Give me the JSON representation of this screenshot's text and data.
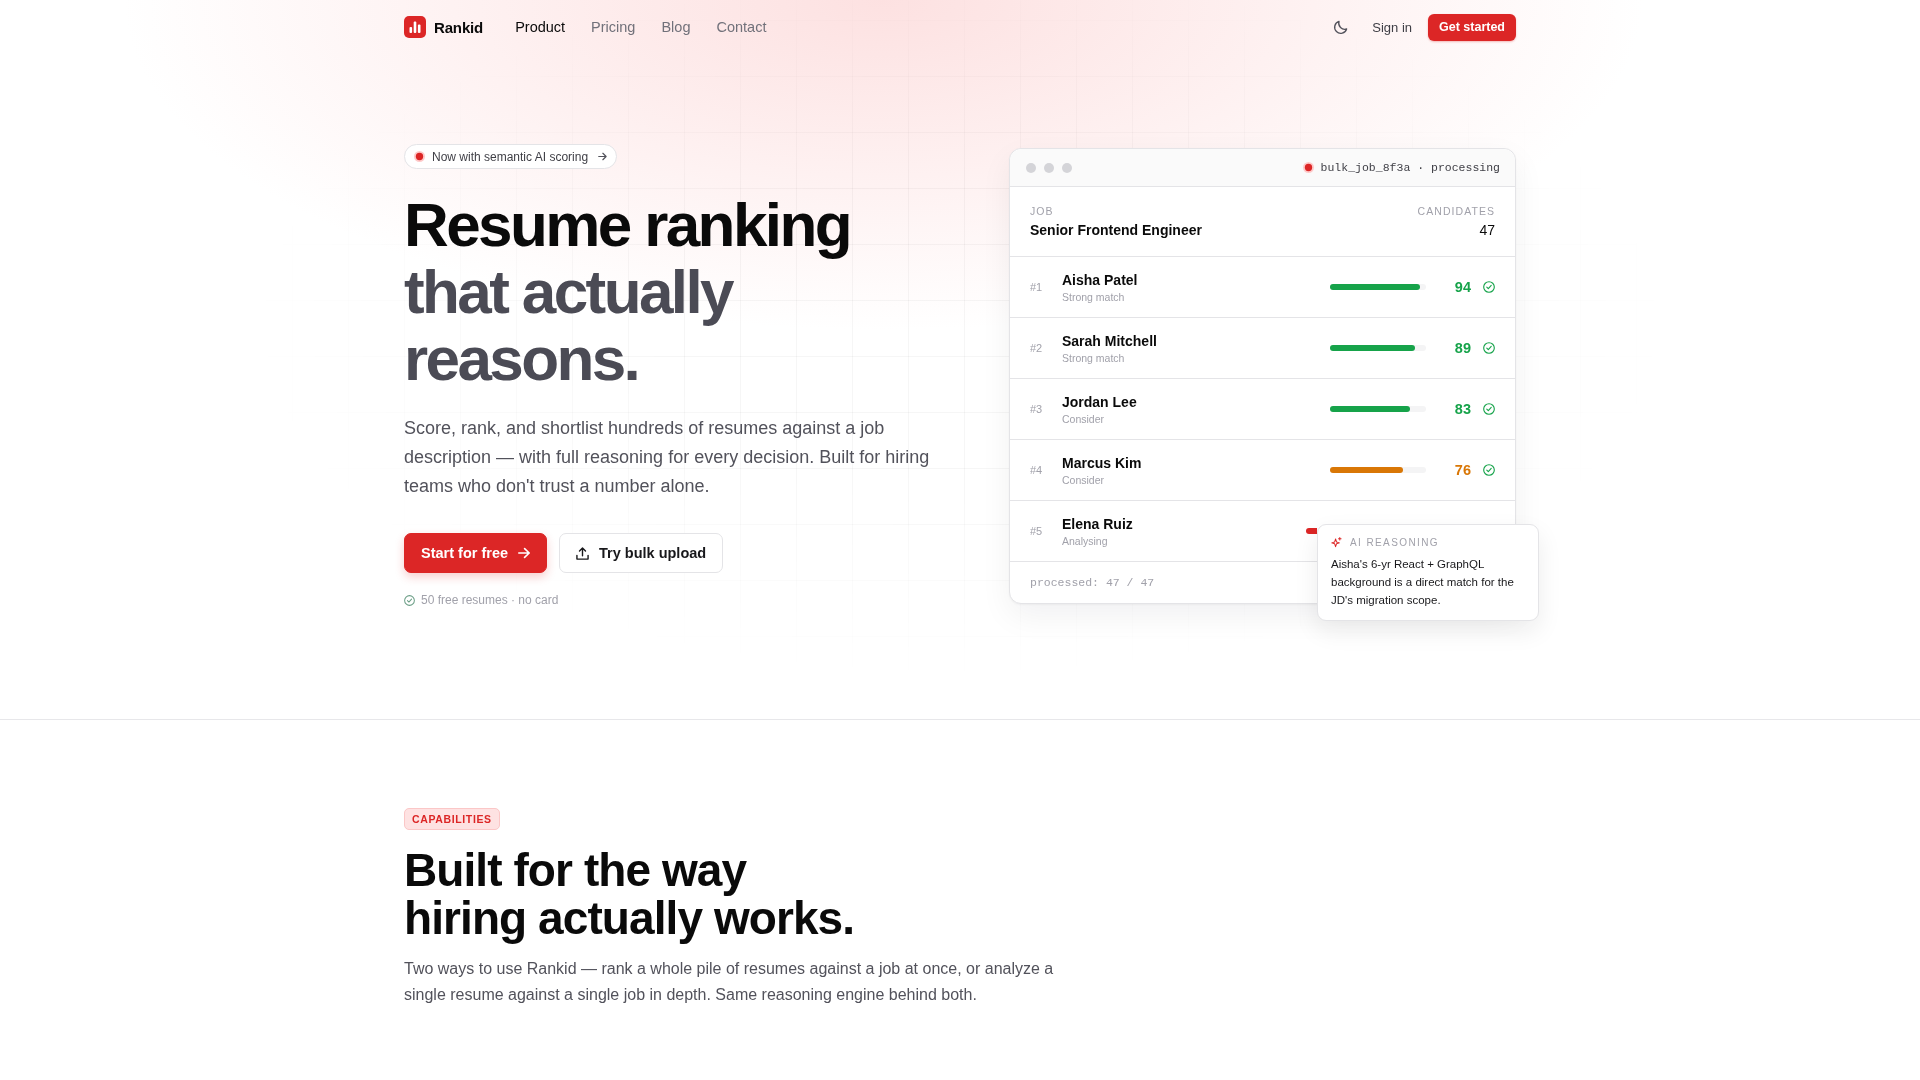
{
  "nav": {
    "brand": "Rankid",
    "links": [
      {
        "label": "Product",
        "selected": true
      },
      {
        "label": "Pricing",
        "selected": false
      },
      {
        "label": "Blog",
        "selected": false
      },
      {
        "label": "Contact",
        "selected": false
      }
    ],
    "sign_in": "Sign in",
    "cta": "Get started"
  },
  "hero": {
    "announcement": "Now with semantic AI scoring",
    "title": "Resume ranking",
    "title_muted": "that actually reasons.",
    "description": "Score, rank, and shortlist hundreds of resumes against a job description — with full reasoning for every decision. Built for hiring teams who don't trust a number alone.",
    "primary_button": "Start for free",
    "secondary_button": "Try bulk upload",
    "note": "50 free resumes · no card"
  },
  "preview": {
    "status_text": "bulk_job_8f3a · processing",
    "job_label": "JOB",
    "job_title": "Senior Frontend Engineer",
    "candidates_label": "CANDIDATES",
    "candidates_count": "47",
    "candidates": [
      {
        "kind": "scored",
        "rank": "#1",
        "name": "Aisha Patel",
        "verdict": "Strong match",
        "score": "94",
        "level": 0.94,
        "color": "#16a34a"
      },
      {
        "kind": "scored",
        "rank": "#2",
        "name": "Sarah Mitchell",
        "verdict": "Strong match",
        "score": "89",
        "level": 0.89,
        "color": "#16a34a"
      },
      {
        "kind": "scored",
        "rank": "#3",
        "name": "Jordan Lee",
        "verdict": "Consider",
        "score": "83",
        "level": 0.83,
        "color": "#16a34a"
      },
      {
        "kind": "scored",
        "rank": "#4",
        "name": "Marcus Kim",
        "verdict": "Consider",
        "score": "76",
        "level": 0.76,
        "color": "#d97706"
      },
      {
        "kind": "analysing",
        "rank": "#5",
        "name": "Elena Ruiz",
        "verdict": "Analysing",
        "color": "#dc2626"
      }
    ],
    "footer": "processed: 47 / 47",
    "reasoning": {
      "label": "AI REASONING",
      "text": "Aisha's 6-yr React + GraphQL background is a direct match for the JD's migration scope."
    }
  },
  "capabilities": {
    "tag": "CAPABILITIES",
    "title_lines": [
      "Built for the way",
      "hiring actually works."
    ],
    "description": "Two ways to use Rankid — rank a whole pile of resumes against a job at once, or analyze a single resume against a single job in depth. Same reasoning engine behind both."
  }
}
